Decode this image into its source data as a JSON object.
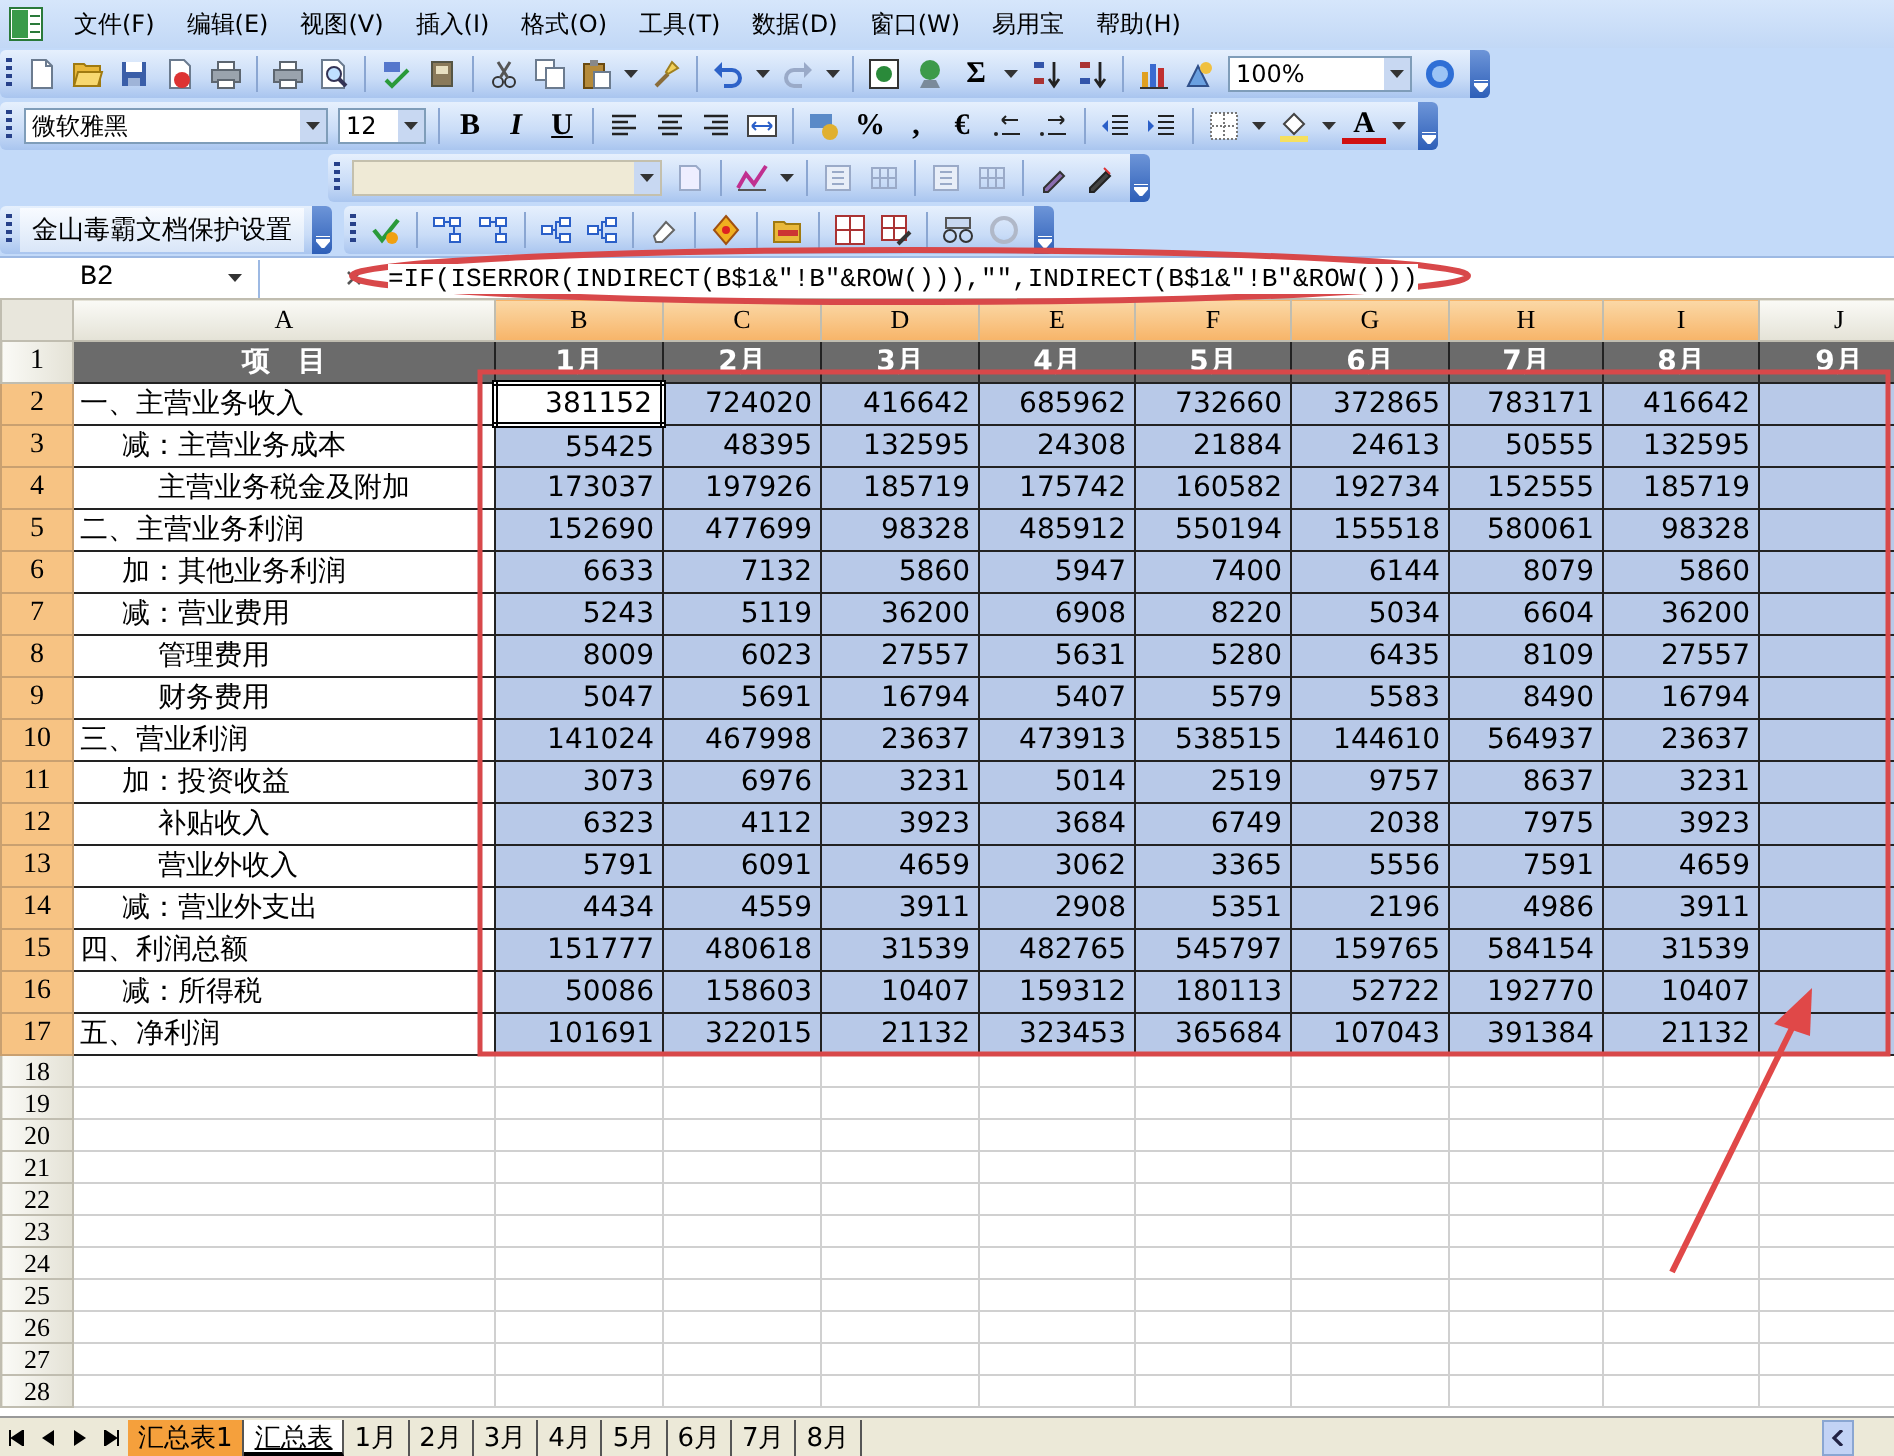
{
  "menu_bar": {
    "items": [
      "文件(F)",
      "编辑(E)",
      "视图(V)",
      "插入(I)",
      "格式(O)",
      "工具(T)",
      "数据(D)",
      "窗口(W)",
      "易用宝",
      "帮助(H)"
    ]
  },
  "toolbars": {
    "sum": "Σ",
    "zoom": "100%",
    "font_name": "微软雅黑",
    "font_size": "12",
    "bold": "B",
    "italic": "I",
    "underline": "U",
    "percent": "%",
    "comma": ",",
    "euro": "€",
    "font_color": "A",
    "protect_button": "金山毒霸文档保护设置"
  },
  "formula_bar": {
    "name_box": "B2",
    "formula": "=IF(ISERROR(INDIRECT(B$1&\"!B\"&ROW())),\"\",INDIRECT(B$1&\"!B\"&ROW()))"
  },
  "columns": [
    {
      "label": "A",
      "selected": false
    },
    {
      "label": "B",
      "selected": true
    },
    {
      "label": "C",
      "selected": true
    },
    {
      "label": "D",
      "selected": true
    },
    {
      "label": "E",
      "selected": true
    },
    {
      "label": "F",
      "selected": true
    },
    {
      "label": "G",
      "selected": true
    },
    {
      "label": "H",
      "selected": true
    },
    {
      "label": "I",
      "selected": true
    },
    {
      "label": "J",
      "selected": false
    }
  ],
  "rows": [
    {
      "number": "1",
      "selected": false,
      "kind": "header",
      "cells": [
        "项　目",
        "1月",
        "2月",
        "3月",
        "4月",
        "5月",
        "6月",
        "7月",
        "8月",
        "9月"
      ]
    },
    {
      "number": "2",
      "selected": true,
      "kind": "heading",
      "active_cell": true,
      "cells": [
        "一、主营业务收入",
        "381152",
        "724020",
        "416642",
        "685962",
        "732660",
        "372865",
        "783171",
        "416642"
      ]
    },
    {
      "number": "3",
      "selected": true,
      "kind": "item",
      "active_cell": false,
      "cells": [
        "减：主营业务成本",
        "55425",
        "48395",
        "132595",
        "24308",
        "21884",
        "24613",
        "50555",
        "132595"
      ]
    },
    {
      "number": "4",
      "selected": true,
      "kind": "detail",
      "active_cell": false,
      "cells": [
        "主营业务税金及附加",
        "173037",
        "197926",
        "185719",
        "175742",
        "160582",
        "192734",
        "152555",
        "185719"
      ]
    },
    {
      "number": "5",
      "selected": true,
      "kind": "heading",
      "active_cell": false,
      "cells": [
        "二、主营业务利润",
        "152690",
        "477699",
        "98328",
        "485912",
        "550194",
        "155518",
        "580061",
        "98328"
      ]
    },
    {
      "number": "6",
      "selected": true,
      "kind": "item",
      "active_cell": false,
      "cells": [
        "加：其他业务利润",
        "6633",
        "7132",
        "5860",
        "5947",
        "7400",
        "6144",
        "8079",
        "5860"
      ]
    },
    {
      "number": "7",
      "selected": true,
      "kind": "item",
      "active_cell": false,
      "cells": [
        "减：营业费用",
        "5243",
        "5119",
        "36200",
        "6908",
        "8220",
        "5034",
        "6604",
        "36200"
      ]
    },
    {
      "number": "8",
      "selected": true,
      "kind": "detail",
      "active_cell": false,
      "cells": [
        "管理费用",
        "8009",
        "6023",
        "27557",
        "5631",
        "5280",
        "6435",
        "8109",
        "27557"
      ]
    },
    {
      "number": "9",
      "selected": true,
      "kind": "detail",
      "active_cell": false,
      "cells": [
        "财务费用",
        "5047",
        "5691",
        "16794",
        "5407",
        "5579",
        "5583",
        "8490",
        "16794"
      ]
    },
    {
      "number": "10",
      "selected": true,
      "kind": "heading",
      "active_cell": false,
      "cells": [
        "三、营业利润",
        "141024",
        "467998",
        "23637",
        "473913",
        "538515",
        "144610",
        "564937",
        "23637"
      ]
    },
    {
      "number": "11",
      "selected": true,
      "kind": "item",
      "active_cell": false,
      "cells": [
        "加：投资收益",
        "3073",
        "6976",
        "3231",
        "5014",
        "2519",
        "9757",
        "8637",
        "3231"
      ]
    },
    {
      "number": "12",
      "selected": true,
      "kind": "detail",
      "active_cell": false,
      "cells": [
        "补贴收入",
        "6323",
        "4112",
        "3923",
        "3684",
        "6749",
        "2038",
        "7975",
        "3923"
      ]
    },
    {
      "number": "13",
      "selected": true,
      "kind": "detail",
      "active_cell": false,
      "cells": [
        "营业外收入",
        "5791",
        "6091",
        "4659",
        "3062",
        "3365",
        "5556",
        "7591",
        "4659"
      ]
    },
    {
      "number": "14",
      "selected": true,
      "kind": "item",
      "active_cell": false,
      "cells": [
        "减：营业外支出",
        "4434",
        "4559",
        "3911",
        "2908",
        "5351",
        "2196",
        "4986",
        "3911"
      ]
    },
    {
      "number": "15",
      "selected": true,
      "kind": "heading",
      "active_cell": false,
      "cells": [
        "四、利润总额",
        "151777",
        "480618",
        "31539",
        "482765",
        "545797",
        "159765",
        "584154",
        "31539"
      ]
    },
    {
      "number": "16",
      "selected": true,
      "kind": "item",
      "active_cell": false,
      "cells": [
        "减：所得税",
        "50086",
        "158603",
        "10407",
        "159312",
        "180113",
        "52722",
        "192770",
        "10407"
      ]
    },
    {
      "number": "17",
      "selected": true,
      "kind": "heading",
      "active_cell": false,
      "cells": [
        "五、净利润",
        "101691",
        "322015",
        "21132",
        "323453",
        "365684",
        "107043",
        "391384",
        "21132"
      ]
    }
  ],
  "empty_rows": [
    "18",
    "19",
    "20",
    "21",
    "22",
    "23",
    "24",
    "25",
    "26",
    "27",
    "28"
  ],
  "sheet_tabs": [
    {
      "label": "汇总表1",
      "selected": false,
      "color": "#f5a03c"
    },
    {
      "label": "汇总表",
      "selected": true
    },
    {
      "label": "1月",
      "selected": false
    },
    {
      "label": "2月",
      "selected": false
    },
    {
      "label": "3月",
      "selected": false
    },
    {
      "label": "4月",
      "selected": false
    },
    {
      "label": "5月",
      "selected": false
    },
    {
      "label": "6月",
      "selected": false
    },
    {
      "label": "7月",
      "selected": false
    },
    {
      "label": "8月",
      "selected": false
    }
  ],
  "annotations": [
    {
      "kind": "ellipse"
    },
    {
      "kind": "rectangle"
    },
    {
      "kind": "arrow"
    }
  ]
}
